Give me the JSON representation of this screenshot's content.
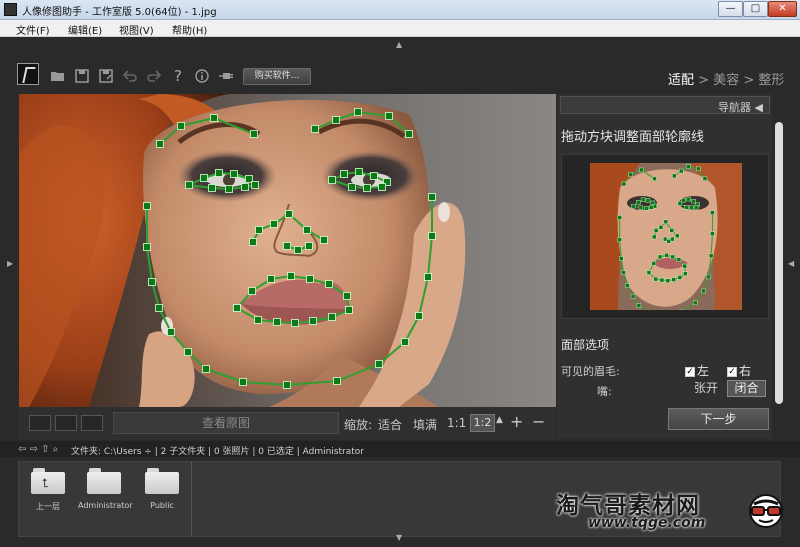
{
  "window": {
    "title": "人像修图助手 - 工作室版 5.0(64位) - 1.jpg",
    "minimize": "—",
    "maximize": "□",
    "close": "✕"
  },
  "menu": [
    "文件(F)",
    "编辑(E)",
    "视图(V)",
    "帮助(H)"
  ],
  "toolbar": {
    "icons": [
      "open-folder-icon",
      "save-icon",
      "save-as-icon",
      "undo-icon",
      "redo-icon",
      "help-icon",
      "info-icon",
      "plugin-icon"
    ],
    "buy_label": "购买软件..."
  },
  "steps": {
    "step1": "适配",
    "sep1": " > ",
    "step2": "美容",
    "sep2": " > ",
    "step3": "整形",
    "active": "适配"
  },
  "viewbar": {
    "view_original": "查看原图",
    "zoom_label": "缩放:",
    "fit": "适合",
    "fill": "填满",
    "one_to_one": "1:1",
    "one_to_two": "1:2",
    "plus": "+",
    "minus": "−"
  },
  "panel": {
    "navigator": "导航器",
    "instruction": "拖动方块调整面部轮廓线",
    "face_options_title": "面部选项",
    "brows_label": "可见的眉毛:",
    "left_label": "左",
    "right_label": "右",
    "left_checked": true,
    "right_checked": true,
    "mouth_label": "嘴:",
    "mouth_open": "张开",
    "mouth_closed": "闭合",
    "mouth_selected": "闭合",
    "next": "下一步"
  },
  "pathbar": {
    "nav": "⇦ ⇨ ⇧ ⌕",
    "text": "文件夹: C:\\Users ÷ | 2 子文件夹 | 0 张照片 | 0 已选定 | Administrator"
  },
  "folders": [
    {
      "name": "上一层",
      "type": "up"
    },
    {
      "name": "Administrator",
      "type": "folder"
    },
    {
      "name": "Public",
      "type": "folder"
    }
  ],
  "watermark": {
    "title": "淘气哥素材网",
    "url": "www.tqge.com"
  },
  "colors": {
    "accent_green": "#2ea02e",
    "marker_green": "#0c7a16",
    "skin": "#c89473",
    "hair": "#a84a1e"
  }
}
